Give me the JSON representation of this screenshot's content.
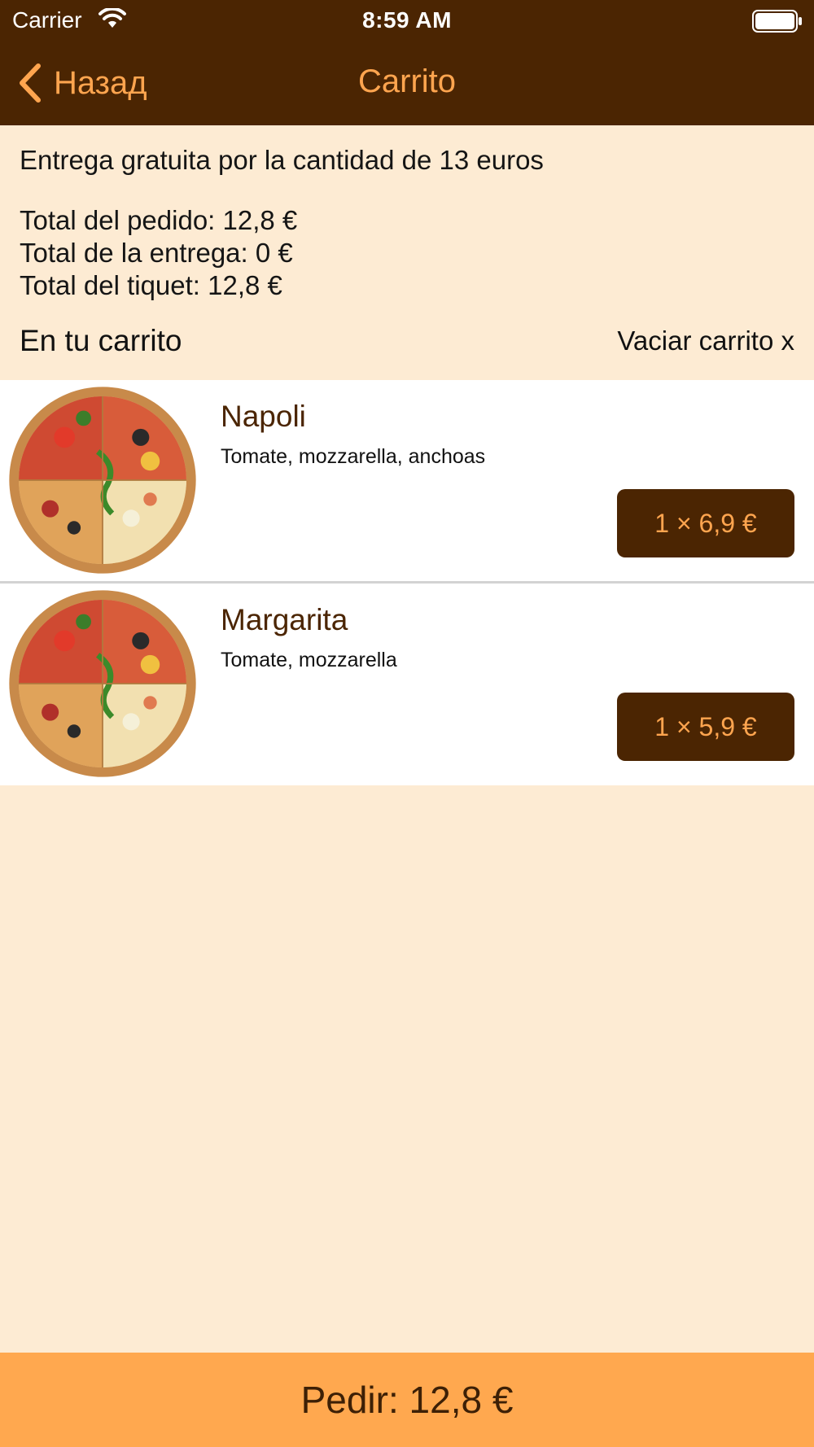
{
  "status_bar": {
    "carrier": "Carrier",
    "time": "8:59 AM",
    "wifi_icon": "wifi-icon",
    "battery_icon": "battery-icon"
  },
  "nav": {
    "back_label": "Назад",
    "title": "Carrito",
    "accent": "#ffa54f",
    "background": "#4b2502"
  },
  "summary": {
    "free_delivery": "Entrega gratuita por la cantidad de 13 euros",
    "order_total": "Total del pedido: 12,8 €",
    "delivery_total": "Total de la entrega: 0 €",
    "ticket_total": "Total del tiquet: 12,8 €"
  },
  "cart": {
    "heading": "En tu carrito",
    "clear_label": "Vaciar carrito x",
    "items": [
      {
        "name": "Napoli",
        "description": "Tomate, mozzarella, anchoas",
        "quantity_price": "1 × 6,9 €",
        "image": "pizza-image"
      },
      {
        "name": "Margarita",
        "description": "Tomate, mozzarella",
        "quantity_price": "1 × 5,9 €",
        "image": "pizza-image"
      }
    ]
  },
  "footer": {
    "order_button": "Pedir: 12,8 €",
    "color": "#ffa84f"
  }
}
